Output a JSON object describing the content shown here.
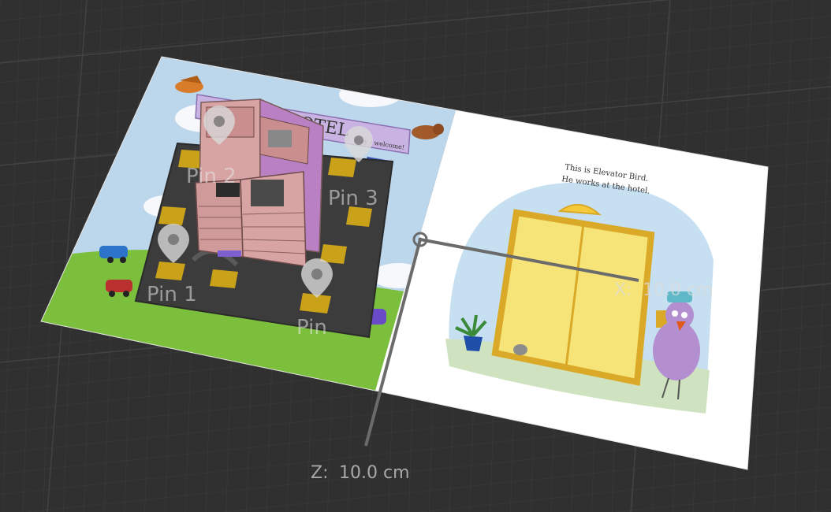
{
  "scene": {
    "grid": true,
    "background_color": "#303030"
  },
  "book": {
    "left_page": {
      "sign_text": "HOTEL",
      "sign_sub": "stay / welcome!"
    },
    "right_page": {
      "caption_line1": "This is Elevator Bird.",
      "caption_line2": "He works at the hotel."
    }
  },
  "pins": [
    {
      "label": "Pin 1"
    },
    {
      "label": "Pin 2"
    },
    {
      "label": "Pin 3"
    },
    {
      "label": "Pin"
    }
  ],
  "measurements": {
    "x": {
      "axis_label": "X:",
      "value": "10.0 cm"
    },
    "z": {
      "axis_label": "Z:",
      "value": "10.0 cm"
    }
  },
  "colors": {
    "accent": "#6b6b6b",
    "sky": "#bcd6ec",
    "grass": "#7cbf3c",
    "building": "#d9a7a5",
    "floor_gold": "#c9a21a"
  }
}
